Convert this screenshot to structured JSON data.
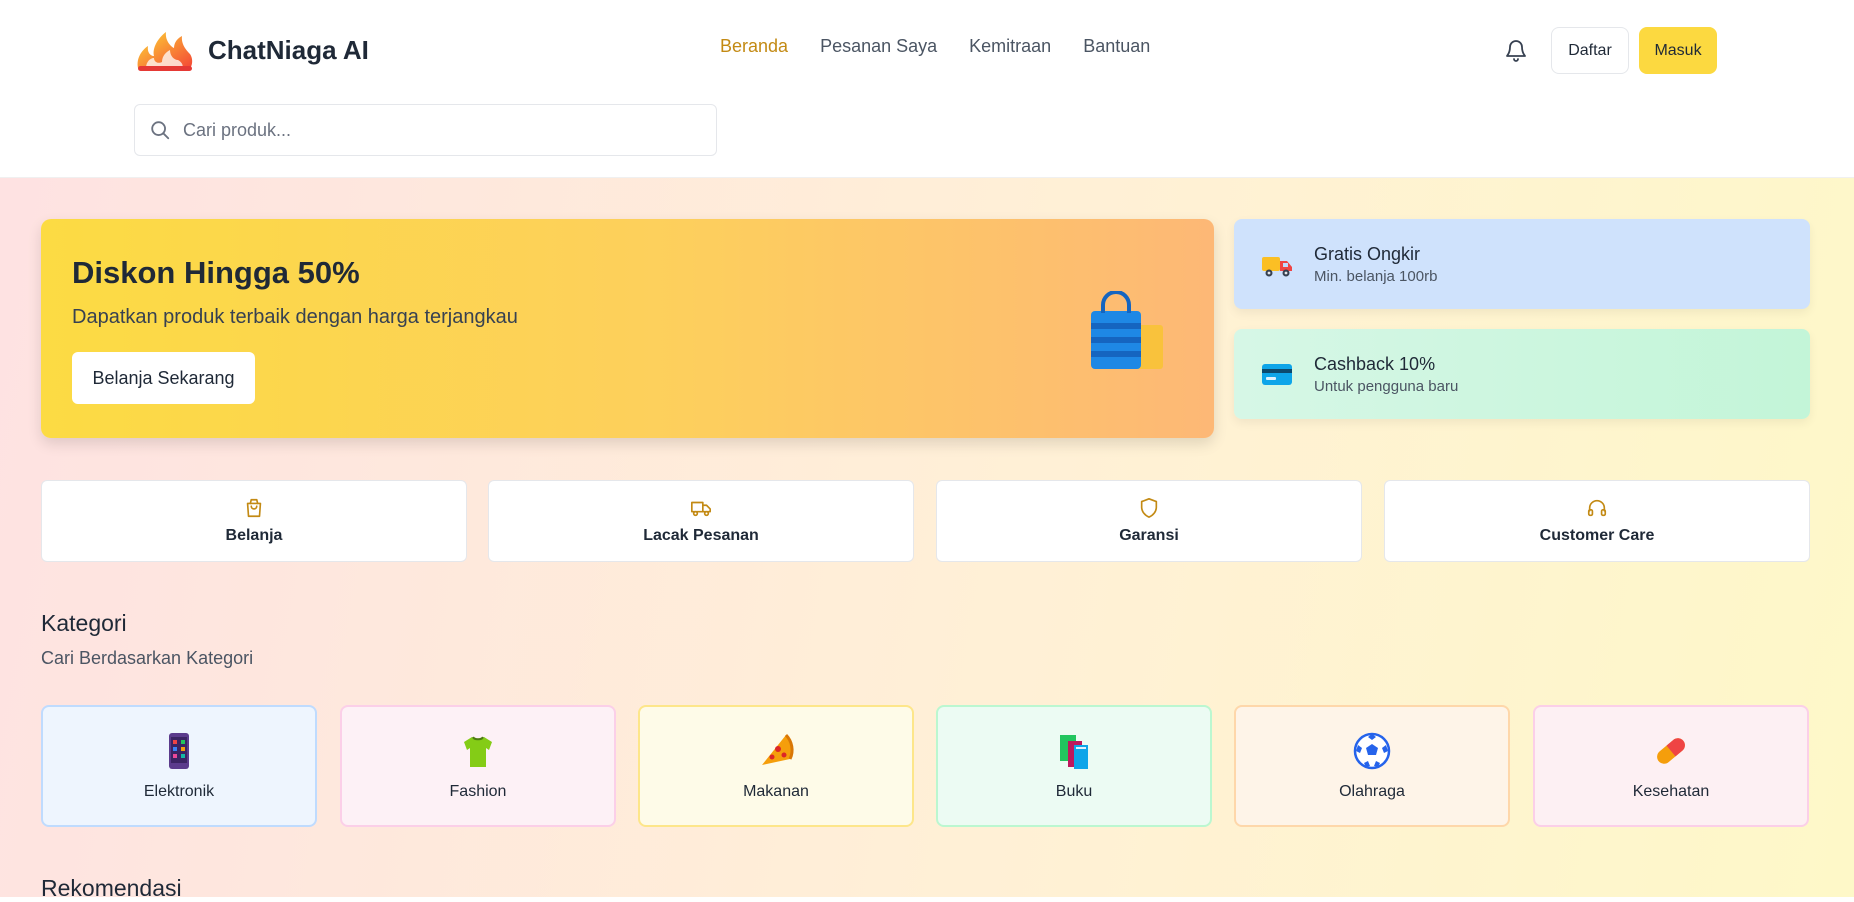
{
  "header": {
    "brand": "ChatNiaga AI",
    "nav": [
      {
        "label": "Beranda",
        "active": true
      },
      {
        "label": "Pesanan Saya",
        "active": false
      },
      {
        "label": "Kemitraan",
        "active": false
      },
      {
        "label": "Bantuan",
        "active": false
      }
    ],
    "register_label": "Daftar",
    "login_label": "Masuk",
    "search_placeholder": "Cari produk..."
  },
  "hero": {
    "title": "Diskon Hingga 50%",
    "subtitle": "Dapatkan produk terbaik dengan harga terjangkau",
    "cta_label": "Belanja Sekarang",
    "icon": "shopping-bag-icon"
  },
  "promos": [
    {
      "title": "Gratis Ongkir",
      "subtitle": "Min. belanja 100rb",
      "icon": "delivery-truck-icon"
    },
    {
      "title": "Cashback 10%",
      "subtitle": "Untuk pengguna baru",
      "icon": "credit-card-icon"
    }
  ],
  "quick_actions": [
    {
      "label": "Belanja",
      "icon": "shopping-bag-icon"
    },
    {
      "label": "Lacak Pesanan",
      "icon": "truck-icon"
    },
    {
      "label": "Garansi",
      "icon": "shield-icon"
    },
    {
      "label": "Customer Care",
      "icon": "headphones-icon"
    }
  ],
  "categories_section": {
    "title": "Kategori",
    "subtitle": "Cari Berdasarkan Kategori",
    "items": [
      {
        "label": "Elektronik",
        "icon": "phone-icon"
      },
      {
        "label": "Fashion",
        "icon": "tshirt-icon"
      },
      {
        "label": "Makanan",
        "icon": "pizza-icon"
      },
      {
        "label": "Buku",
        "icon": "books-icon"
      },
      {
        "label": "Olahraga",
        "icon": "soccer-ball-icon"
      },
      {
        "label": "Kesehatan",
        "icon": "pill-icon"
      }
    ]
  },
  "recommendations_section": {
    "title": "Rekomendasi"
  },
  "colors": {
    "accent": "#fcd940",
    "nav_active": "#c38a14",
    "quick_icon": "#c38a14"
  }
}
